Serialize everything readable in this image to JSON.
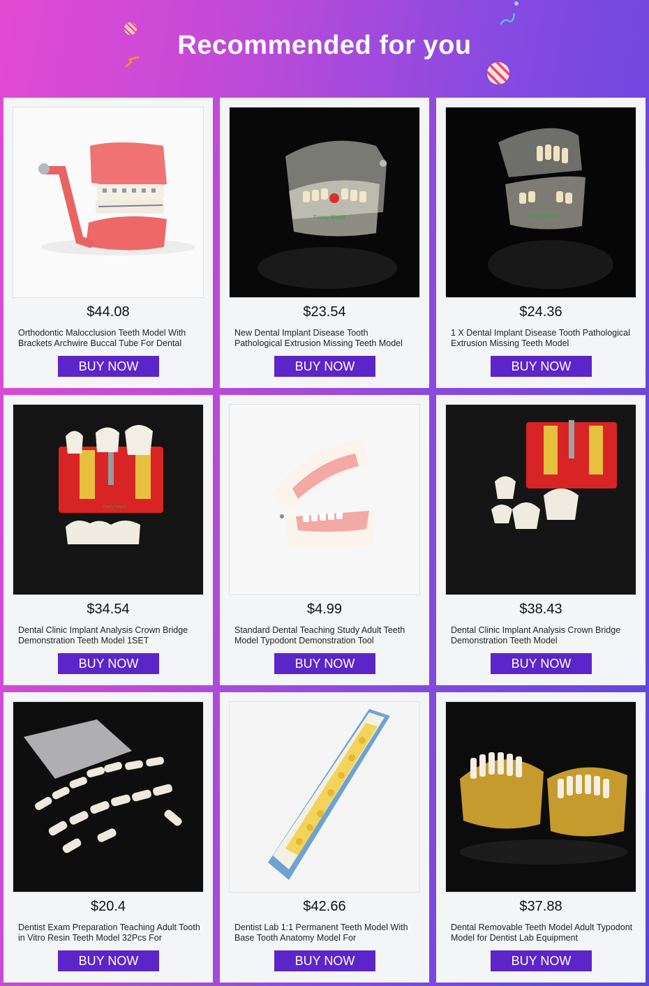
{
  "header": {
    "title": "Recommended for you"
  },
  "colors": {
    "button": "#5c25c9",
    "card": "#f4f5f7",
    "gradient_left": "#e34ad2",
    "gradient_right": "#5a45e0"
  },
  "products": [
    {
      "price": "$44.08",
      "name": "Orthodontic Malocclusion Teeth Model With Brackets Archwire Buccal Tube For Dental",
      "button": "BUY NOW",
      "image": "pink-orthodontic-model"
    },
    {
      "price": "$23.54",
      "name": "New Dental Implant Disease Tooth Pathological Extrusion Missing Teeth Model",
      "button": "BUY NOW",
      "image": "clear-implant-model"
    },
    {
      "price": "$24.36",
      "name": "1 X Dental Implant Disease Tooth Pathological Extrusion Missing Teeth Model",
      "button": "BUY NOW",
      "image": "clear-implant-model-side"
    },
    {
      "price": "$34.54",
      "name": "Dental Clinic Implant Analysis Crown Bridge Demonstration Teeth Model 1SET",
      "button": "BUY NOW",
      "image": "red-crown-bridge-model"
    },
    {
      "price": "$4.99",
      "name": "Standard Dental Teaching Study Adult Teeth Model Typodont Demonstration Tool",
      "button": "BUY NOW",
      "image": "typodont-model"
    },
    {
      "price": "$38.43",
      "name": "Dental Clinic Implant Analysis Crown Bridge Demonstration Teeth Model",
      "button": "BUY NOW",
      "image": "red-crown-model-crowns"
    },
    {
      "price": "$20.4",
      "name": "Dentist Exam Preparation Teaching Adult Tooth in Vitro Resin Teeth Model 32Pcs For",
      "button": "BUY NOW",
      "image": "loose-resin-teeth"
    },
    {
      "price": "$42.66",
      "name": "Dentist Lab 1:1 Permanent Teeth Model With Base Tooth Anatomy Model For",
      "button": "BUY NOW",
      "image": "yellow-teeth-box"
    },
    {
      "price": "$37.88",
      "name": "Dental Removable Teeth Model Adult Typodont Model for Dentist Lab Equipment",
      "button": "BUY NOW",
      "image": "amber-jaw-models"
    }
  ]
}
